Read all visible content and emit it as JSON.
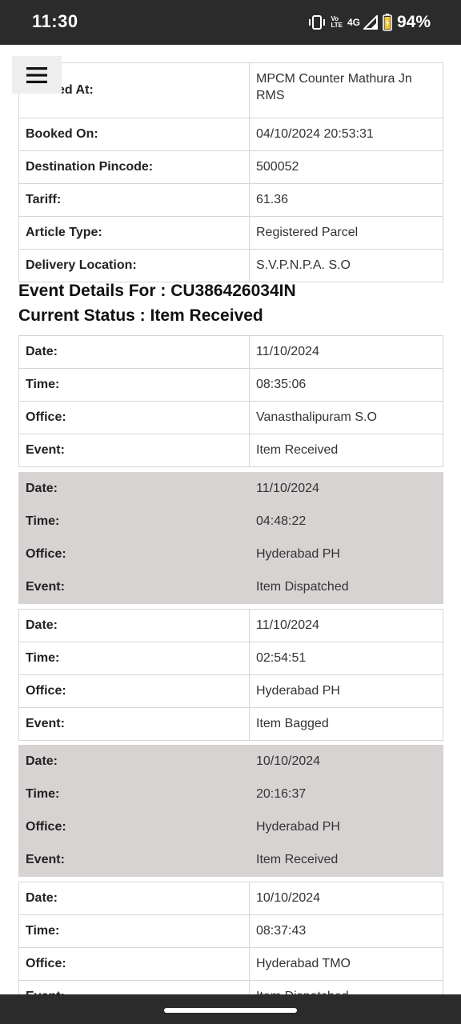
{
  "status_bar": {
    "time": "11:30",
    "volte_top": "Vo",
    "volte_bottom": "LTE",
    "network": "4G",
    "battery": "94%",
    "icons": [
      "vibrate-icon",
      "volte-icon",
      "signal-icon",
      "battery-icon"
    ]
  },
  "menu": {
    "icon": "hamburger-menu-icon"
  },
  "booking_details": [
    {
      "label": "Booked At:",
      "value": "MPCM Counter Mathura Jn RMS"
    },
    {
      "label": "Booked On:",
      "value": "04/10/2024 20:53:31"
    },
    {
      "label": "Destination Pincode:",
      "value": "500052"
    },
    {
      "label": "Tariff:",
      "value": "61.36"
    },
    {
      "label": "Article Type:",
      "value": "Registered Parcel"
    },
    {
      "label": "Delivery Location:",
      "value": "S.V.P.N.P.A. S.O"
    }
  ],
  "event_heading": "Event Details For : CU386426034IN",
  "status_heading": "Current Status : Item Received",
  "labels": {
    "date": "Date:",
    "time": "Time:",
    "office": "Office:",
    "event": "Event:"
  },
  "events": [
    {
      "date": "11/10/2024",
      "time": "08:35:06",
      "office": "Vanasthalipuram S.O",
      "event": "Item Received"
    },
    {
      "date": "11/10/2024",
      "time": "04:48:22",
      "office": "Hyderabad PH",
      "event": "Item Dispatched"
    },
    {
      "date": "11/10/2024",
      "time": "02:54:51",
      "office": "Hyderabad PH",
      "event": "Item Bagged"
    },
    {
      "date": "10/10/2024",
      "time": "20:16:37",
      "office": "Hyderabad PH",
      "event": "Item Received"
    },
    {
      "date": "10/10/2024",
      "time": "08:37:43",
      "office": "Hyderabad TMO",
      "event": "Item Dispatched"
    }
  ]
}
